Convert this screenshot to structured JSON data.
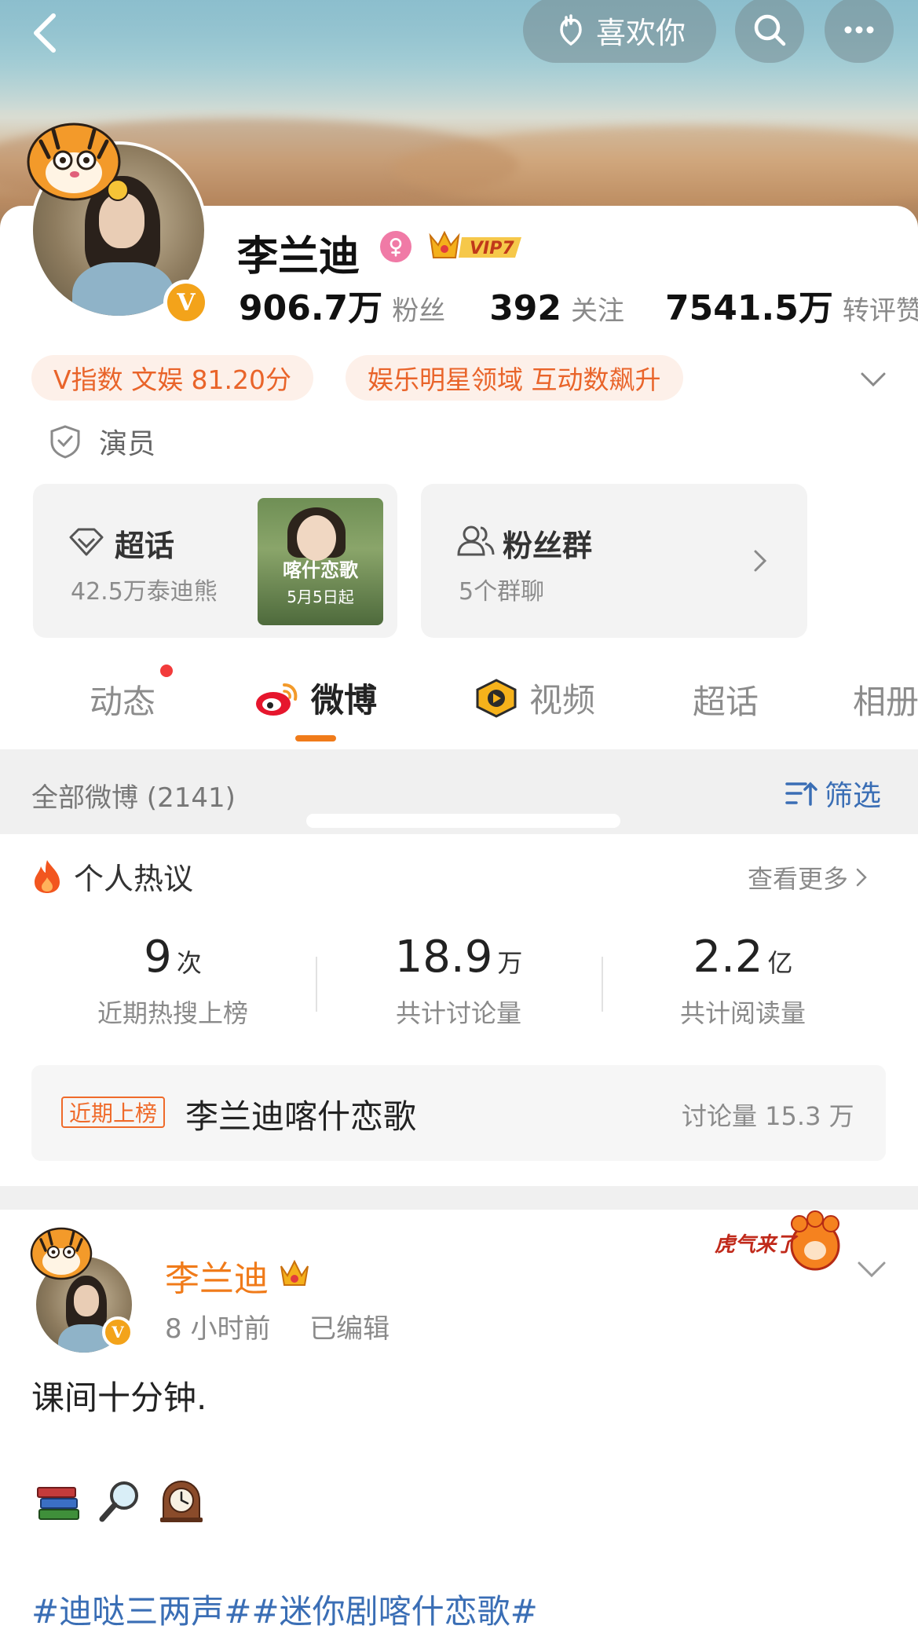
{
  "header": {
    "like_label": "喜欢你"
  },
  "profile": {
    "name": "李兰迪",
    "vip_label": "VIP7",
    "verify_letter": "V",
    "stats": [
      {
        "value": "906.7万",
        "label": "粉丝"
      },
      {
        "value": "392",
        "label": "关注"
      },
      {
        "value": "7541.5万",
        "label": "转评赞"
      }
    ],
    "pills": [
      "V指数 文娱 81.20分",
      "娱乐明星领域 互动数飙升"
    ],
    "verification": "演员"
  },
  "cards": {
    "supertopic": {
      "title": "超话",
      "subtitle": "42.5万泰迪熊",
      "poster_title": "喀什恋歌",
      "poster_date": "5月5日起"
    },
    "fangroup": {
      "title": "粉丝群",
      "subtitle": "5个群聊"
    }
  },
  "tabs": [
    {
      "label": "动态"
    },
    {
      "label": "微博"
    },
    {
      "label": "视频"
    },
    {
      "label": "超话"
    },
    {
      "label": "相册"
    }
  ],
  "filter": {
    "all_label": "全部微博 (2141)",
    "filter_label": "筛选"
  },
  "hot": {
    "title": "个人热议",
    "more_label": "查看更多",
    "metrics": [
      {
        "value": "9",
        "unit": "次",
        "label": "近期热搜上榜"
      },
      {
        "value": "18.9",
        "unit": "万",
        "label": "共计讨论量"
      },
      {
        "value": "2.2",
        "unit": "亿",
        "label": "共计阅读量"
      }
    ],
    "trend": {
      "tag": "近期上榜",
      "title": "李兰迪喀什恋歌",
      "count": "讨论量 15.3 万"
    }
  },
  "post": {
    "author": "李兰迪",
    "time": "8 小时前",
    "edited": "已编辑",
    "text": "课间十分钟.",
    "sticker_text": "虎气来了",
    "tags": "#迪哒三两声##迷你剧喀什恋歌#"
  },
  "colors": {
    "accent_orange": "#f07b1a",
    "link_blue": "#3a6eb5",
    "badge_gold": "#f3a31a",
    "pill_text": "#e9642a"
  }
}
